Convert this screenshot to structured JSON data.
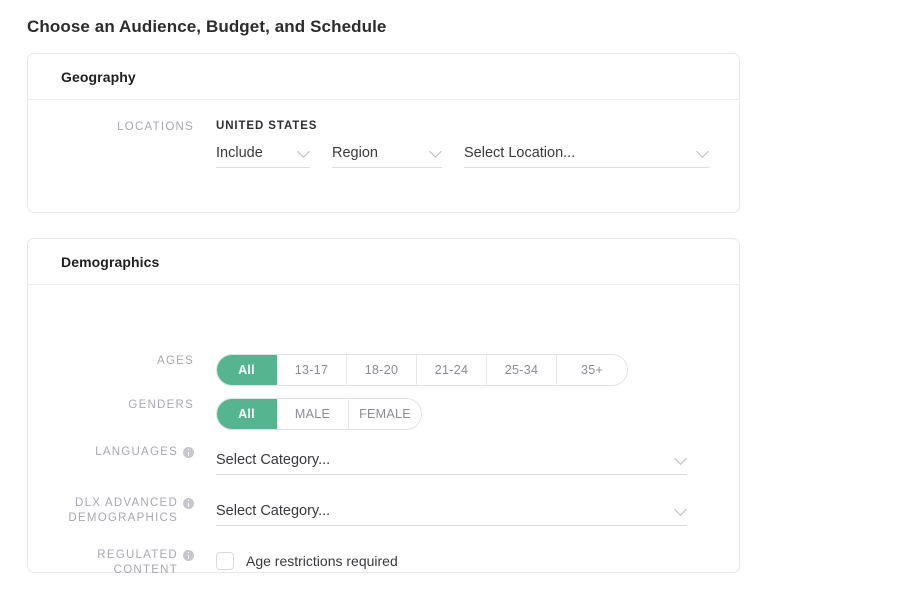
{
  "page": {
    "title": "Choose an Audience, Budget, and Schedule",
    "accent_color": "#55b591",
    "label_color": "#a8a8b0",
    "text_color": "#3a3a3e",
    "card_border_color": "#e8e8ea",
    "background": "#ffffff"
  },
  "geography": {
    "card_title": "Geography",
    "locations": {
      "label": "LOCATIONS",
      "country_heading": "UNITED STATES",
      "include_select": {
        "value": "Include",
        "icon": "chevron-down-icon"
      },
      "region_select": {
        "value": "Region",
        "icon": "chevron-down-icon"
      },
      "location_select": {
        "value": "Select Location...",
        "icon": "chevron-down-icon"
      }
    }
  },
  "demographics": {
    "card_title": "Demographics",
    "ages": {
      "label": "AGES",
      "options": [
        "All",
        "13-17",
        "18-20",
        "21-24",
        "25-34",
        "35+"
      ],
      "selected": "All"
    },
    "genders": {
      "label": "GENDERS",
      "options": [
        "All",
        "MALE",
        "FEMALE"
      ],
      "selected": "All"
    },
    "languages": {
      "label": "LANGUAGES",
      "info_icon": "info-icon",
      "select": {
        "value": "Select Category...",
        "icon": "chevron-down-icon"
      }
    },
    "dlx_advanced_demographics": {
      "label_line1": "DLX ADVANCED",
      "label_line2": "DEMOGRAPHICS",
      "info_icon": "info-icon",
      "select": {
        "value": "Select Category...",
        "icon": "chevron-down-icon"
      }
    },
    "regulated_content": {
      "label_line1": "REGULATED",
      "label_line2": "CONTENT",
      "info_icon": "info-icon",
      "checkbox": {
        "label": "Age restrictions required",
        "checked": false
      }
    }
  }
}
